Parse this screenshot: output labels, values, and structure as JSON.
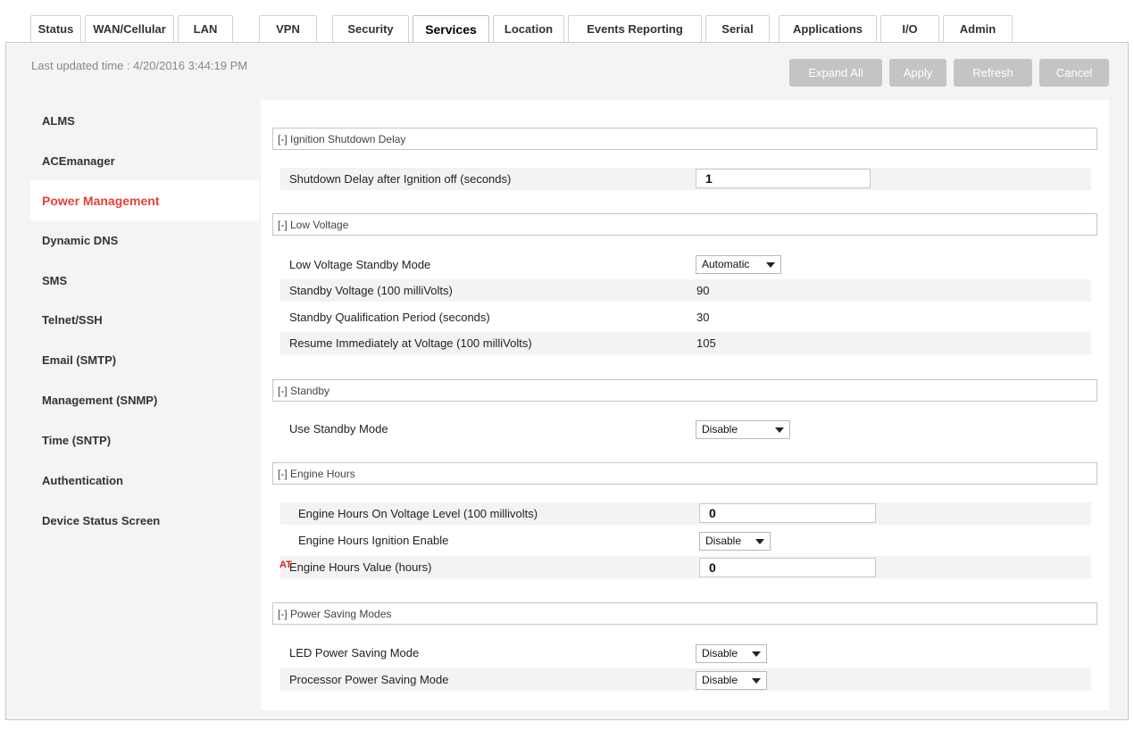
{
  "tabs": [
    "Status",
    "WAN/Cellular",
    "LAN",
    "VPN",
    "Security",
    "Services",
    "Location",
    "Events Reporting",
    "Serial",
    "Applications",
    "I/O",
    "Admin"
  ],
  "active_tab": "Services",
  "last_updated": "Last updated time : 4/20/2016 3:44:19 PM",
  "toolbar": {
    "expand_all": "Expand All",
    "apply": "Apply",
    "refresh": "Refresh",
    "cancel": "Cancel"
  },
  "sidebar": {
    "active": "Power Management",
    "items": [
      "ALMS",
      "ACEmanager",
      "Power Management",
      "Dynamic DNS",
      "SMS",
      "Telnet/SSH",
      "Email (SMTP)",
      "Management (SNMP)",
      "Time (SNTP)",
      "Authentication",
      "Device Status Screen"
    ]
  },
  "sections": {
    "ignition": {
      "header": "[-] Ignition Shutdown Delay",
      "shutdown_delay_label": "Shutdown Delay after Ignition off (seconds)",
      "shutdown_delay_value": "1"
    },
    "low_voltage": {
      "header": "[-] Low Voltage",
      "standby_mode_label": "Low Voltage Standby Mode",
      "standby_mode_value": "Automatic",
      "standby_voltage_label": "Standby Voltage (100 milliVolts)",
      "standby_voltage_value": "90",
      "qualification_label": "Standby Qualification Period (seconds)",
      "qualification_value": "30",
      "resume_label": "Resume Immediately at Voltage (100 milliVolts)",
      "resume_value": "105"
    },
    "standby": {
      "header": "[-] Standby",
      "use_standby_label": "Use Standby Mode",
      "use_standby_value": "Disable"
    },
    "engine_hours": {
      "header": "[-] Engine Hours",
      "voltage_level_label": "Engine Hours On Voltage Level (100 millivolts)",
      "voltage_level_value": "0",
      "ignition_enable_label": "Engine Hours Ignition Enable",
      "ignition_enable_value": "Disable",
      "at_badge": "AT",
      "hours_value_label": "Engine Hours Value (hours)",
      "hours_value_value": "0"
    },
    "power_saving": {
      "header": "[-] Power Saving Modes",
      "led_label": "LED Power Saving Mode",
      "led_value": "Disable",
      "processor_label": "Processor Power Saving Mode",
      "processor_value": "Disable"
    }
  }
}
